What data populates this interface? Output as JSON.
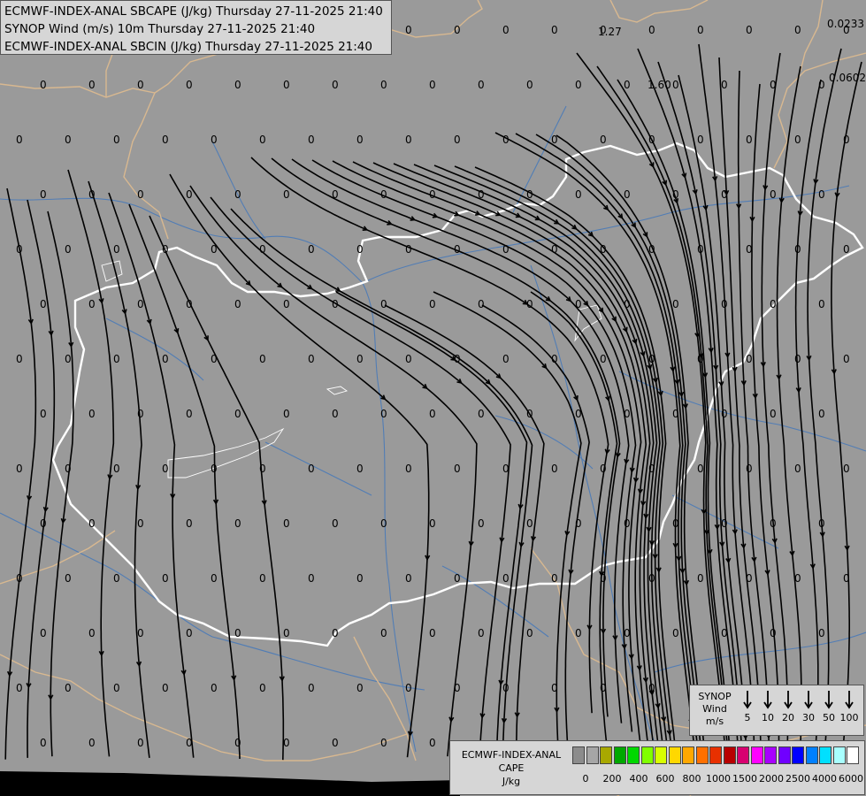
{
  "titles": [
    "ECMWF-INDEX-ANAL SBCAPE (J/kg) Thursday 27-11-2025 21:40",
    "SYNOP Wind (m/s) 10m Thursday 27-11-2025 21:40",
    "ECMWF-INDEX-ANAL SBCIN (J/kg) Thursday 27-11-2025 21:40"
  ],
  "wind_legend": {
    "title_lines": [
      "SYNOP",
      "Wind",
      "m/s"
    ],
    "speeds": [
      "5",
      "10",
      "20",
      "30",
      "50",
      "100"
    ]
  },
  "cape_legend": {
    "title_lines": [
      "ECMWF-INDEX-ANAL",
      "CAPE",
      "J/kg"
    ],
    "colors": [
      "#8c8c8c",
      "#a6a6a6",
      "#a8a800",
      "#00a800",
      "#00d800",
      "#80ff00",
      "#d8ff00",
      "#ffd800",
      "#ffa800",
      "#ff7000",
      "#e83000",
      "#b80000",
      "#d80070",
      "#ff00ff",
      "#a800ff",
      "#7000ff",
      "#0000ff",
      "#0080ff",
      "#00e0ff",
      "#a8ffff",
      "#ffffff"
    ],
    "ticks": [
      "0",
      "200",
      "400",
      "600",
      "800",
      "1000",
      "1500",
      "2000",
      "2500",
      "4000",
      "6000"
    ]
  },
  "map_values": [
    "0",
    "1.27",
    "1.60",
    "0.0233",
    "0.0602"
  ],
  "colors": {
    "background": "#9a9a9a",
    "country_border": "#d8b890",
    "hungary_border": "#ffffff",
    "rivers": "#4a7ab8",
    "streamlines": "#000000"
  }
}
